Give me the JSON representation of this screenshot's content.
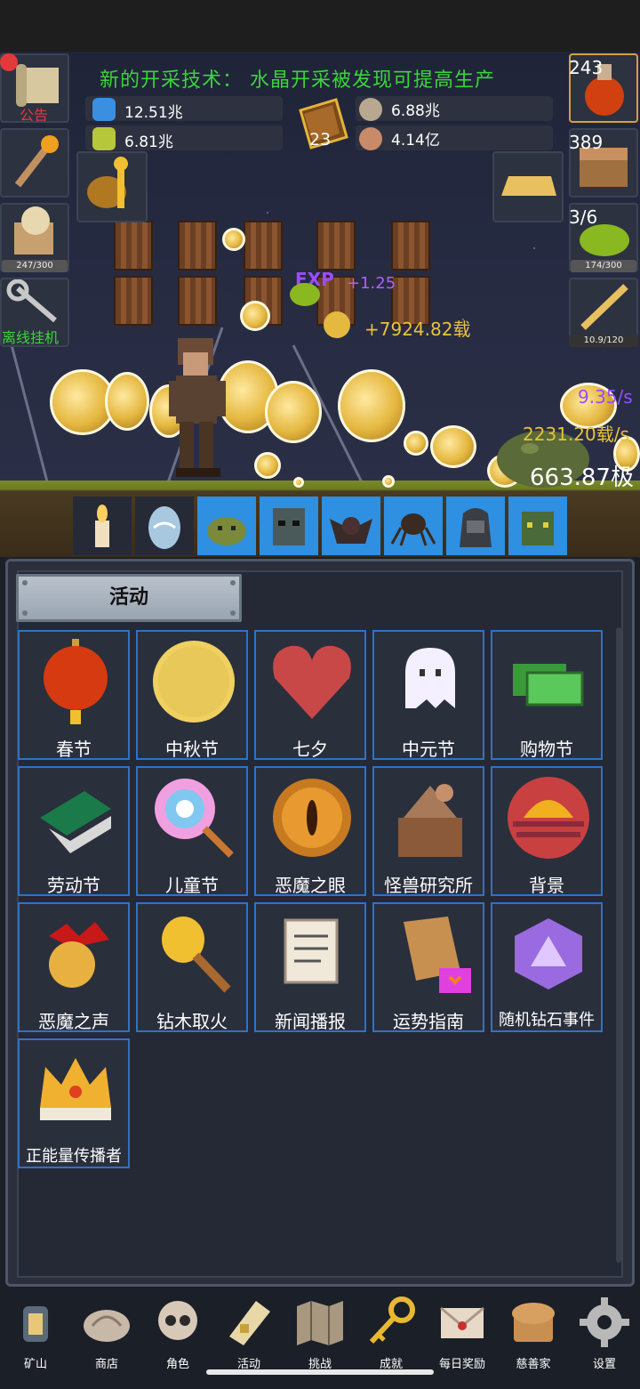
{
  "ticker": "新的开采技术： 水晶开采被发现可提高生产",
  "resources": {
    "blue_potion": "12.51兆",
    "green_potion": "6.81兆",
    "book_count": "23",
    "ore": "6.88兆",
    "meat": "4.14亿"
  },
  "left_buttons": {
    "notice_label": "公告",
    "progress": "247/300",
    "offline_label": "离线挂机"
  },
  "right_buttons": {
    "potion_count": "243",
    "chest_count": "389",
    "slime_count": "3/6",
    "slime_progress": "174/300",
    "sword_progress": "10.9/120"
  },
  "floating": {
    "exp": "EXP",
    "exp_gain": "+1.25",
    "gold_gain": "+7924.82载",
    "rate1": "9.35/s",
    "rate2": "2231.20载/s",
    "total": "663.87极"
  },
  "panel": {
    "tab": "活动",
    "items": [
      {
        "label": "春节",
        "icon": "lantern-icon"
      },
      {
        "label": "中秋节",
        "icon": "moon-icon"
      },
      {
        "label": "七夕",
        "icon": "heart-icon"
      },
      {
        "label": "中元节",
        "icon": "ghost-icon"
      },
      {
        "label": "购物节",
        "icon": "cash-icon"
      },
      {
        "label": "劳动节",
        "icon": "brush-icon"
      },
      {
        "label": "儿童节",
        "icon": "lollipop-icon"
      },
      {
        "label": "恶魔之眼",
        "icon": "eye-icon"
      },
      {
        "label": "怪兽研究所",
        "icon": "lab-icon"
      },
      {
        "label": "背景",
        "icon": "sunset-icon"
      },
      {
        "label": "恶魔之声",
        "icon": "bell-icon"
      },
      {
        "label": "钻木取火",
        "icon": "torch-icon"
      },
      {
        "label": "新闻播报",
        "icon": "news-icon"
      },
      {
        "label": "运势指南",
        "icon": "fortune-icon"
      },
      {
        "label": "随机钻石事件",
        "icon": "diamond-icon"
      },
      {
        "label": "正能量传播者",
        "icon": "crown-icon"
      }
    ]
  },
  "nav": [
    {
      "label": "矿山",
      "icon": "lantern-nav-icon"
    },
    {
      "label": "商店",
      "icon": "shell-icon"
    },
    {
      "label": "角色",
      "icon": "skull-icon"
    },
    {
      "label": "活动",
      "icon": "scroll-icon"
    },
    {
      "label": "挑战",
      "icon": "map-icon"
    },
    {
      "label": "成就",
      "icon": "key-icon"
    },
    {
      "label": "每日奖励",
      "icon": "letter-icon"
    },
    {
      "label": "慈善家",
      "icon": "bread-icon"
    },
    {
      "label": "设置",
      "icon": "gear-icon"
    }
  ],
  "colors": {
    "ticker": "#3bd43b",
    "cell_border": "#2d73c8",
    "slot_blue": "#2f8fe0",
    "gold_text": "#e8c23a",
    "exp_purple": "#9b4dff"
  }
}
